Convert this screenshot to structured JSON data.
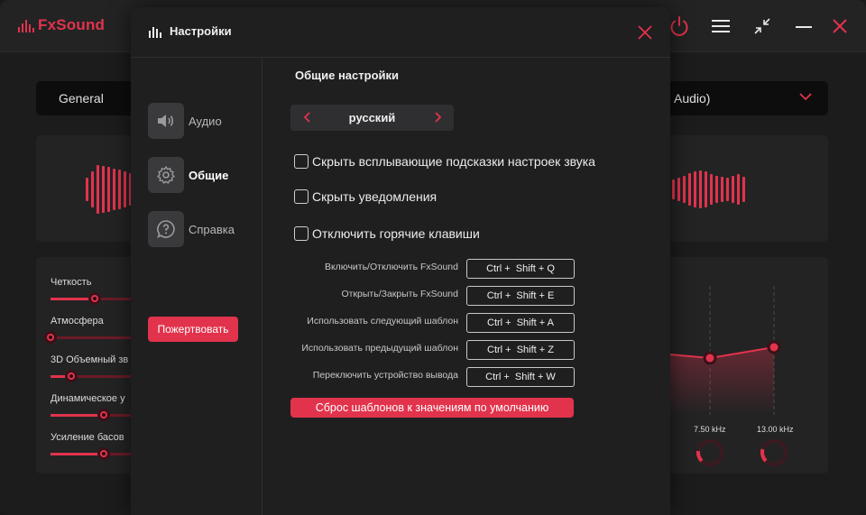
{
  "app": {
    "brand": "FxSound",
    "preset": "General",
    "device": "Audio)",
    "effects": [
      {
        "label": "Четкость",
        "value": 0.27
      },
      {
        "label": "Атмосфера",
        "value": 0.0
      },
      {
        "label": "3D Объемный зв",
        "value": 0.13
      },
      {
        "label": "Динамическое у",
        "value": 0.33
      },
      {
        "label": "Усиление басов",
        "value": 0.33
      }
    ],
    "eq": {
      "bands": [
        "7.50 kHz",
        "13.00 kHz"
      ]
    },
    "accent_color": "#e2334c"
  },
  "settings": {
    "title": "Настройки",
    "nav": [
      {
        "label": "Аудио",
        "icon": "speaker-icon",
        "active": false
      },
      {
        "label": "Общие",
        "icon": "gear-icon",
        "active": true
      },
      {
        "label": "Справка",
        "icon": "help-icon",
        "active": false
      }
    ],
    "donate_label": "Пожертвовать",
    "section_title": "Общие настройки",
    "language": "русский",
    "checkboxes": [
      {
        "label": "Скрыть всплывающие подсказки настроек звука",
        "checked": false
      },
      {
        "label": "Скрыть уведомления",
        "checked": false
      },
      {
        "label": "Отключить горячие клавиши",
        "checked": false
      }
    ],
    "hotkeys": [
      {
        "label": "Включить/Отключить FxSound",
        "keys": "Ctrl +  Shift + Q"
      },
      {
        "label": "Открыть/Закрыть FxSound",
        "keys": "Ctrl +  Shift + E"
      },
      {
        "label": "Использовать следующий шаблон",
        "keys": "Ctrl +  Shift + A"
      },
      {
        "label": "Использовать предыдущий шаблон",
        "keys": "Ctrl +  Shift + Z"
      },
      {
        "label": "Переключить устройство вывода",
        "keys": "Ctrl +  Shift + W"
      }
    ],
    "reset_label": "Сброс шаблонов к значениям по умолчанию"
  }
}
